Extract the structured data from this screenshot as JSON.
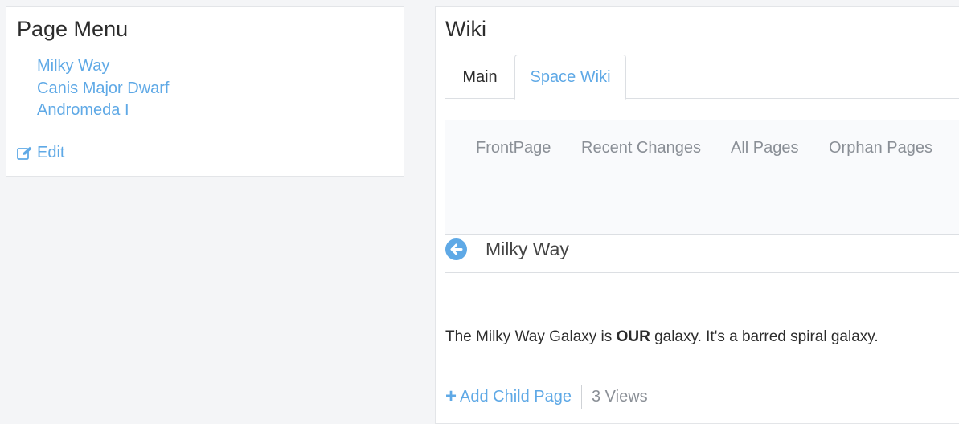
{
  "page_menu": {
    "title": "Page Menu",
    "items": [
      {
        "label": "Milky Way"
      },
      {
        "label": "Canis Major Dwarf"
      },
      {
        "label": "Andromeda I"
      }
    ],
    "edit_label": "Edit",
    "edit_icon": "edit-icon"
  },
  "wiki": {
    "title": "Wiki",
    "tabs": [
      {
        "label": "Main",
        "active": false
      },
      {
        "label": "Space Wiki",
        "active": true
      }
    ],
    "subnav": [
      {
        "label": "FrontPage"
      },
      {
        "label": "Recent Changes"
      },
      {
        "label": "All Pages"
      },
      {
        "label": "Orphan Pages"
      }
    ],
    "page": {
      "back_icon": "arrow-circle-left-icon",
      "name": "Milky Way",
      "content_prefix": "The Milky Way Galaxy is ",
      "content_bold": "OUR",
      "content_suffix": " galaxy. It's a barred spiral galaxy."
    },
    "footer": {
      "add_child_label": "Add Child Page",
      "add_child_icon": "plus-icon",
      "views": "3 Views"
    }
  },
  "colors": {
    "accent": "#5fa9e6",
    "text": "#2c2c2c",
    "muted": "#8a8f96",
    "background": "#f4f5f7"
  }
}
